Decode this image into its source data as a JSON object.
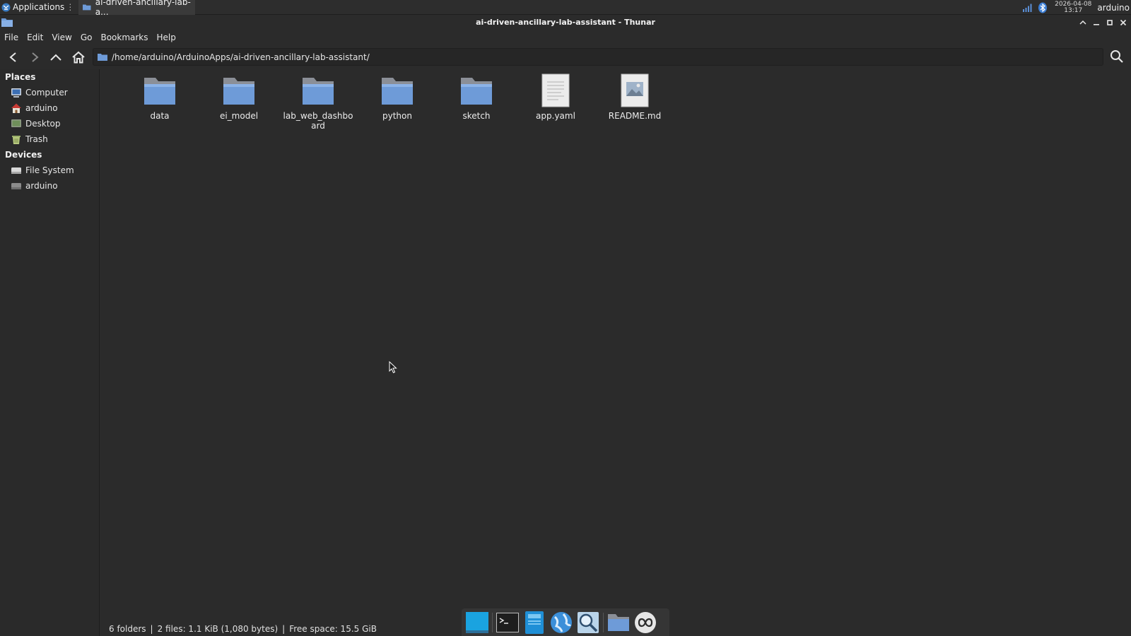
{
  "panel": {
    "apps_label": "Applications",
    "task_label": "ai-driven-ancillary-lab-a...",
    "date": "2026-04-08",
    "time": "13:17",
    "user": "arduino"
  },
  "window": {
    "title": "ai-driven-ancillary-lab-assistant - Thunar"
  },
  "menubar": {
    "items": [
      "File",
      "Edit",
      "View",
      "Go",
      "Bookmarks",
      "Help"
    ]
  },
  "location": {
    "path": "/home/arduino/ArduinoApps/ai-driven-ancillary-lab-assistant/"
  },
  "sidebar": {
    "places_header": "Places",
    "places": [
      {
        "label": "Computer",
        "icon": "computer-icon"
      },
      {
        "label": "arduino",
        "icon": "home-icon"
      },
      {
        "label": "Desktop",
        "icon": "desktop-icon"
      },
      {
        "label": "Trash",
        "icon": "trash-icon"
      }
    ],
    "devices_header": "Devices",
    "devices": [
      {
        "label": "File System",
        "icon": "drive-icon"
      },
      {
        "label": "arduino",
        "icon": "drive-icon"
      }
    ]
  },
  "files": [
    {
      "name": "data",
      "type": "folder"
    },
    {
      "name": "ei_model",
      "type": "folder"
    },
    {
      "name": "lab_web_dashboard",
      "type": "folder"
    },
    {
      "name": "python",
      "type": "folder"
    },
    {
      "name": "sketch",
      "type": "folder"
    },
    {
      "name": "app.yaml",
      "type": "text"
    },
    {
      "name": "README.md",
      "type": "image-doc"
    }
  ],
  "status": {
    "folders": "6 folders",
    "files": "2 files: 1.1 KiB (1,080 bytes)",
    "free": "Free space: 15.5 GiB"
  },
  "dock": {
    "items": [
      "show-desktop-icon",
      "terminal-icon",
      "file-manager-icon",
      "web-browser-icon",
      "search-icon",
      "folder-icon",
      "arduino-icon"
    ]
  },
  "colors": {
    "folder_blue": "#6e9bd8",
    "background": "#2b2b2b"
  }
}
